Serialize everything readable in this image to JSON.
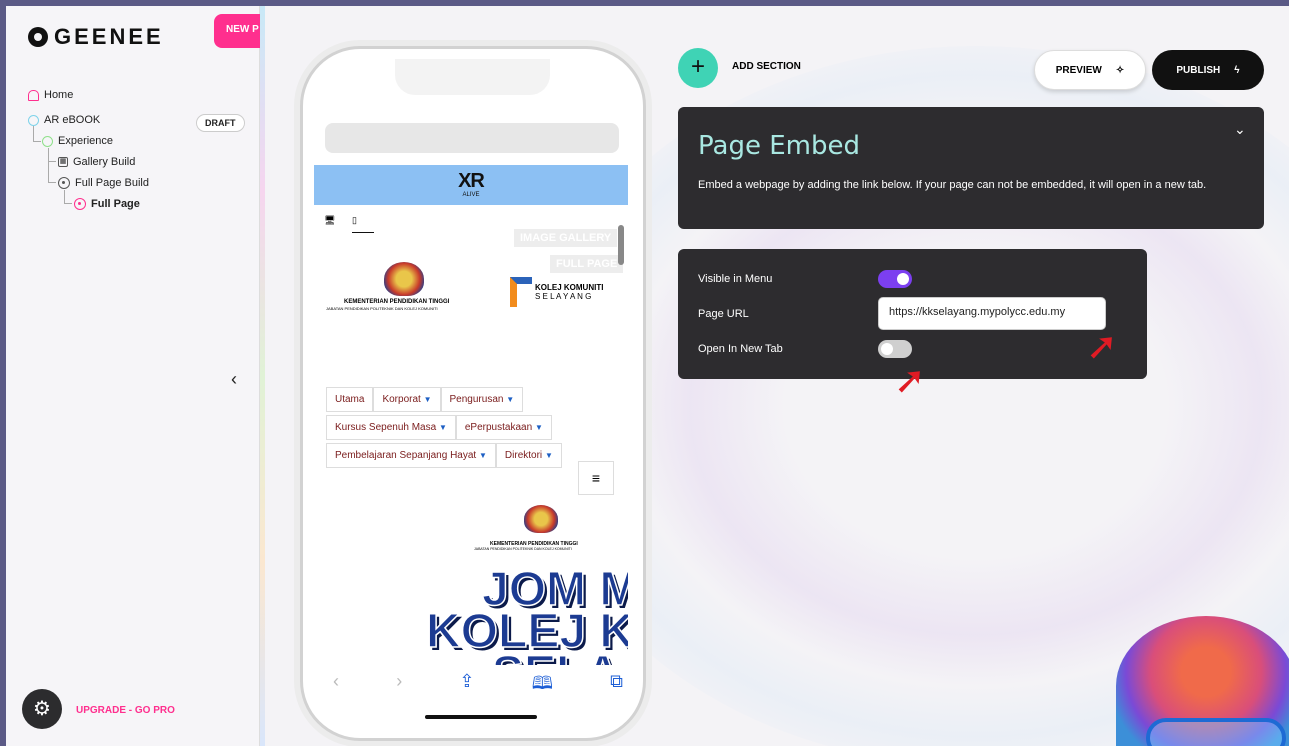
{
  "brand": {
    "logo_text": "GEENEE",
    "new_project_label": "NEW P"
  },
  "sidebar": {
    "home": "Home",
    "project": "AR eBOOK",
    "status_badge": "DRAFT",
    "experience": "Experience",
    "gallery_build": "Gallery Build",
    "full_page_build": "Full Page Build",
    "full_page": "Full Page",
    "upgrade": "UPGRADE - GO PRO",
    "collapse_icon": "chevron-left-icon",
    "settings_icon": "gear-icon"
  },
  "phone": {
    "xr_logo": "XR",
    "xr_sub": "ALIVE",
    "ghost_tab_1": "IMAGE GALLERY",
    "ghost_tab_2": "FULL PAGE",
    "ministry": "KEMENTERIAN PENDIDIKAN TINGGI",
    "ministry_sub": "JABATAN PENDIDIKAN POLITEKNIK DAN KOLEJ KOMUNITI",
    "kk_line1": "KOLEJ KOMUNITI",
    "kk_line2": "S E L A Y A N G",
    "nav_row1": [
      "Utama",
      "Korporat",
      "Pengurusan"
    ],
    "nav_row2": [
      "Kursus Sepenuh Masa",
      "ePerpustakaan"
    ],
    "nav_row3": [
      "Pembelajaran Sepanjang Hayat",
      "Direktori"
    ],
    "burger": "≡",
    "ministry2": "KEMENTERIAN PENDIDIKAN TINGGI",
    "ministry2_sub": "JABATAN PENDIDIKAN POLITEKNIK DAN KOLEJ KOMUNITI",
    "headline1": "JOM M",
    "headline2": "KOLEJ K",
    "headline3": "SELA"
  },
  "toolbar": {
    "add_section": "ADD SECTION",
    "preview": "PREVIEW",
    "publish": "PUBLISH"
  },
  "embed": {
    "title": "Page Embed",
    "description": "Embed a webpage by adding the link below. If your page can not be embedded, it will open in a new tab."
  },
  "settings": {
    "visible_label": "Visible in Menu",
    "visible_on": true,
    "url_label": "Page URL",
    "url_value": "https://kkselayang.mypolycc.edu.my",
    "new_tab_label": "Open In New Tab",
    "new_tab_on": false
  },
  "colors": {
    "accent_pink": "#ff2f8e",
    "accent_teal": "#3fd3b5",
    "toggle_purple": "#7c3ff0",
    "panel": "#2d2c2f"
  }
}
